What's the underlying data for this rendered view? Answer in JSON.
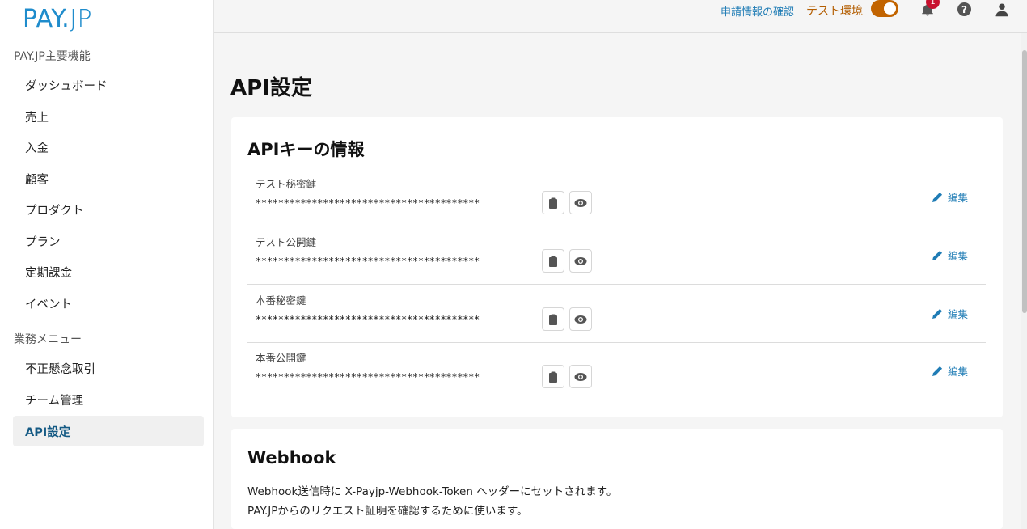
{
  "brand": {
    "logo_main": "PAY.",
    "logo_jp": "JP"
  },
  "sidebar": {
    "section1": "PAY.JP主要機能",
    "items1": [
      "ダッシュボード",
      "売上",
      "入金",
      "顧客",
      "プロダクト",
      "プラン",
      "定期課金",
      "イベント"
    ],
    "section2": "業務メニュー",
    "items2": [
      "不正懸念取引",
      "チーム管理",
      "API設定"
    ],
    "active": "API設定"
  },
  "topbar": {
    "link": "申請情報の確認",
    "env_label": "テスト環境",
    "env_toggle_on": true,
    "notification_count": "1",
    "help_glyph": "?"
  },
  "colors": {
    "accent": "#1f8ccc",
    "link": "#1f7cb5",
    "env": "#c26400",
    "badge": "#c8102e"
  },
  "main": {
    "title": "API設定",
    "api_card": {
      "title": "APIキーの情報",
      "edit_label": "編集",
      "keys": [
        {
          "label": "テスト秘密鍵",
          "value": "****************************************"
        },
        {
          "label": "テスト公開鍵",
          "value": "****************************************"
        },
        {
          "label": "本番秘密鍵",
          "value": "****************************************"
        },
        {
          "label": "本番公開鍵",
          "value": "****************************************"
        }
      ]
    },
    "webhook_card": {
      "title": "Webhook",
      "line1": "Webhook送信時に X-Payjp-Webhook-Token ヘッダーにセットされます。",
      "line2": "PAY.JPからのリクエスト証明を確認するために使います。"
    }
  }
}
